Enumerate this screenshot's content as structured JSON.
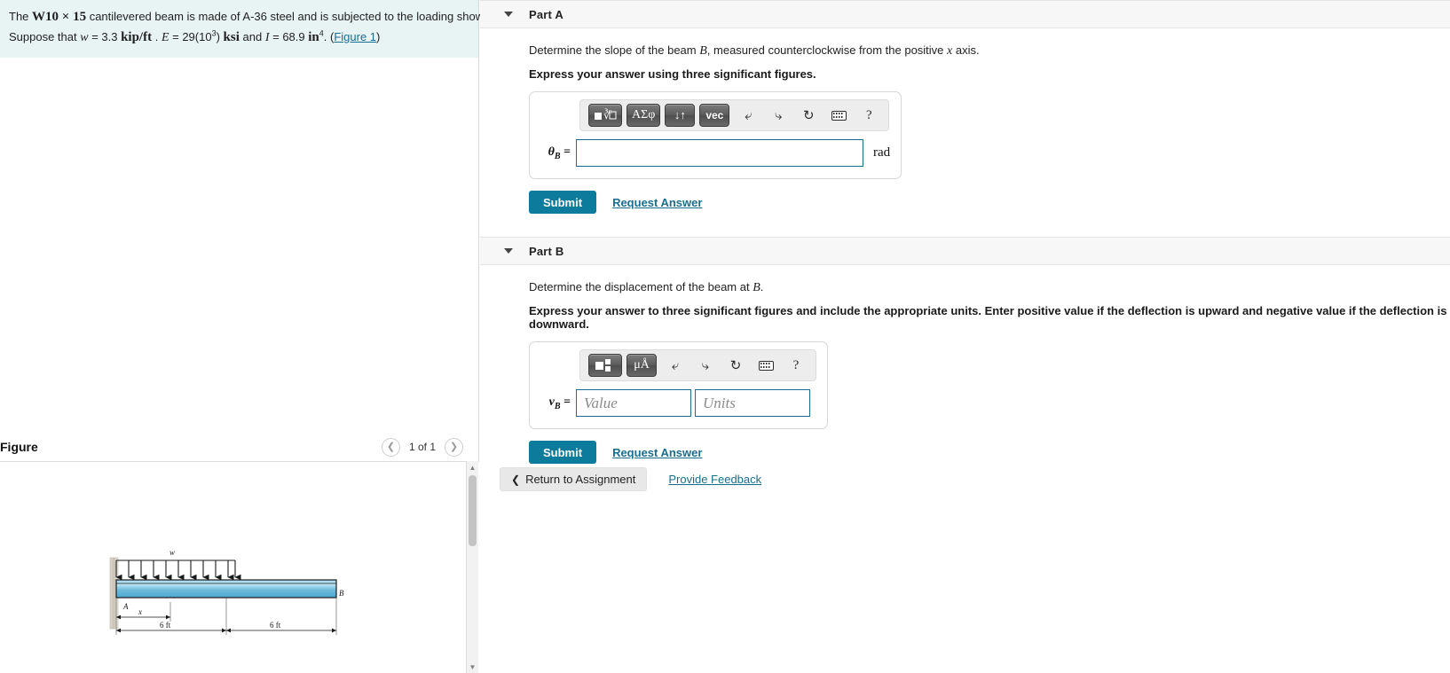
{
  "problem": {
    "line1_a": "The ",
    "line1_beam": "W10 × 15",
    "line1_b": " cantilevered beam is made of A-36 steel and is subjected to the loading shown.",
    "line2_a": "Suppose that ",
    "line2_w": "w",
    "line2_weq": " = 3.3 ",
    "line2_wunit": "kip/ft",
    "line2_dot": " . ",
    "line2_E": "E",
    "line2_Eeq": " = 29(10",
    "line2_Eexp": "3",
    "line2_Eclose": ") ",
    "line2_Eunit": "ksi",
    "line2_and": " and ",
    "line2_I": "I",
    "line2_Ieq": " = 68.9 ",
    "line2_Iunit": "in",
    "line2_Iexp": "4",
    "line2_period": ". (",
    "figure_link": "Figure 1",
    "line2_end": ")"
  },
  "figure": {
    "title": "Figure",
    "pager_label": "1 of 1",
    "prev_icon": "chevron-left-icon",
    "next_icon": "chevron-right-icon",
    "diagram": {
      "load_label": "w",
      "point_a": "A",
      "point_b": "B",
      "x_label": "x",
      "dim_left": "6 ft",
      "dim_right": "6 ft"
    }
  },
  "parts": [
    {
      "id": "part-a",
      "label": "Part A",
      "question": "Determine the slope of the beam B, measured counterclockwise from the positive x axis.",
      "question_pre": "Determine the slope of the beam ",
      "question_var": "B",
      "question_mid": ", measured counterclockwise from the positive ",
      "question_var2": "x",
      "question_post": " axis.",
      "instruction": "Express your answer using three significant figures.",
      "variable": "θ",
      "variable_sub": "B",
      "variable_eq": " =",
      "value": "",
      "placeholder": "",
      "unit": "rad",
      "toolbar": {
        "buttons": [
          "■ⁿ√□",
          "ΑΣφ",
          "↓↑",
          "vec"
        ],
        "undo_icon": "undo-icon",
        "redo_icon": "redo-icon",
        "reset_icon": "reset-icon",
        "keyboard_icon": "keyboard-icon",
        "help_icon": "help-icon",
        "help_label": "?"
      },
      "submit_label": "Submit",
      "request_label": "Request Answer"
    },
    {
      "id": "part-b",
      "label": "Part B",
      "question_pre": "Determine the displacement of the beam at ",
      "question_var": "B",
      "question_post": ".",
      "instruction": "Express your answer to three significant figures and include the appropriate units. Enter positive value if the deflection is upward and negative value if the deflection is downward.",
      "variable": "v",
      "variable_sub": "B",
      "variable_eq": " =",
      "value": "",
      "placeholder_value": "Value",
      "placeholder_units": "Units",
      "toolbar": {
        "buttons": [
          "unit-template",
          "μÅ"
        ],
        "undo_icon": "undo-icon",
        "redo_icon": "redo-icon",
        "reset_icon": "reset-icon",
        "keyboard_icon": "keyboard-icon",
        "help_icon": "help-icon",
        "help_label": "?"
      },
      "submit_label": "Submit",
      "request_label": "Request Answer"
    }
  ],
  "footer": {
    "return_label": "Return to Assignment",
    "return_icon": "chevron-left-icon",
    "feedback_label": "Provide Feedback"
  },
  "colors": {
    "accent": "#0d7b9b",
    "link": "#1a6d8f",
    "problem_bg": "#e8f4f4",
    "header_bg": "#f7f7f7",
    "beam_fill": "#79c3e0"
  }
}
